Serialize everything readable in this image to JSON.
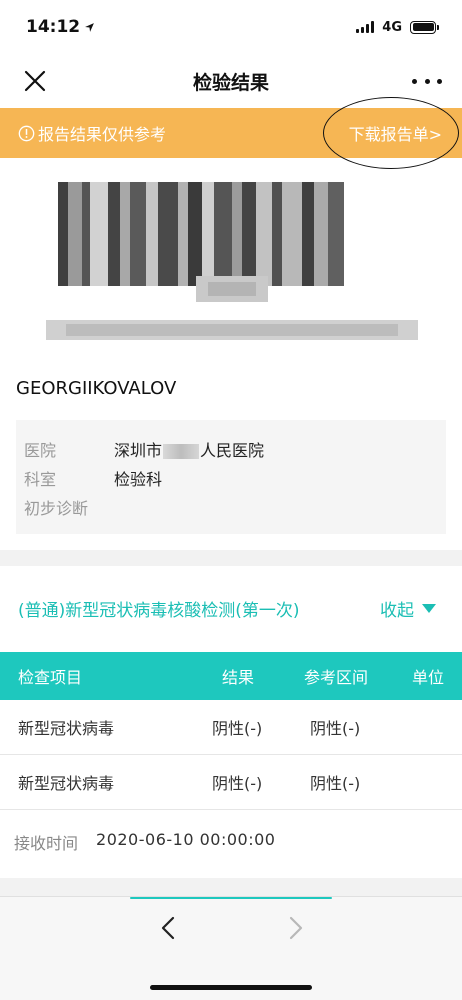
{
  "status_bar": {
    "time": "14:12",
    "network": "4G"
  },
  "nav": {
    "title": "检验结果"
  },
  "notice": {
    "text": "报告结果仅供参考",
    "download_label": "下载报告单>"
  },
  "patient": {
    "name": "GEORGIIKOVALOV"
  },
  "info": {
    "hospital_label": "医院",
    "hospital_prefix": "深圳市",
    "hospital_suffix": "人民医院",
    "department_label": "科室",
    "department_value": "检验科",
    "diagnosis_label": "初步诊断",
    "diagnosis_value": ""
  },
  "test": {
    "title": "(普通)新型冠状病毒核酸检测(第一次)",
    "collapse_label": "收起"
  },
  "table": {
    "headers": [
      "检查项目",
      "结果",
      "参考区间",
      "单位"
    ],
    "rows": [
      {
        "item": "新型冠状病毒",
        "result": "阴性(-)",
        "reference": "阴性(-)",
        "unit": ""
      },
      {
        "item": "新型冠状病毒",
        "result": "阴性(-)",
        "reference": "阴性(-)",
        "unit": ""
      }
    ]
  },
  "receive": {
    "label": "接收时间",
    "value": "2020-06-10 00:00:00"
  },
  "colors": {
    "accent": "#1ec8be",
    "notice_bg": "#f6b654"
  },
  "icons": {
    "close": "close-icon",
    "more": "more-icon",
    "info": "info-circle-icon",
    "collapse": "triangle-down-icon",
    "back": "chevron-left-icon",
    "forward": "chevron-right-icon"
  }
}
